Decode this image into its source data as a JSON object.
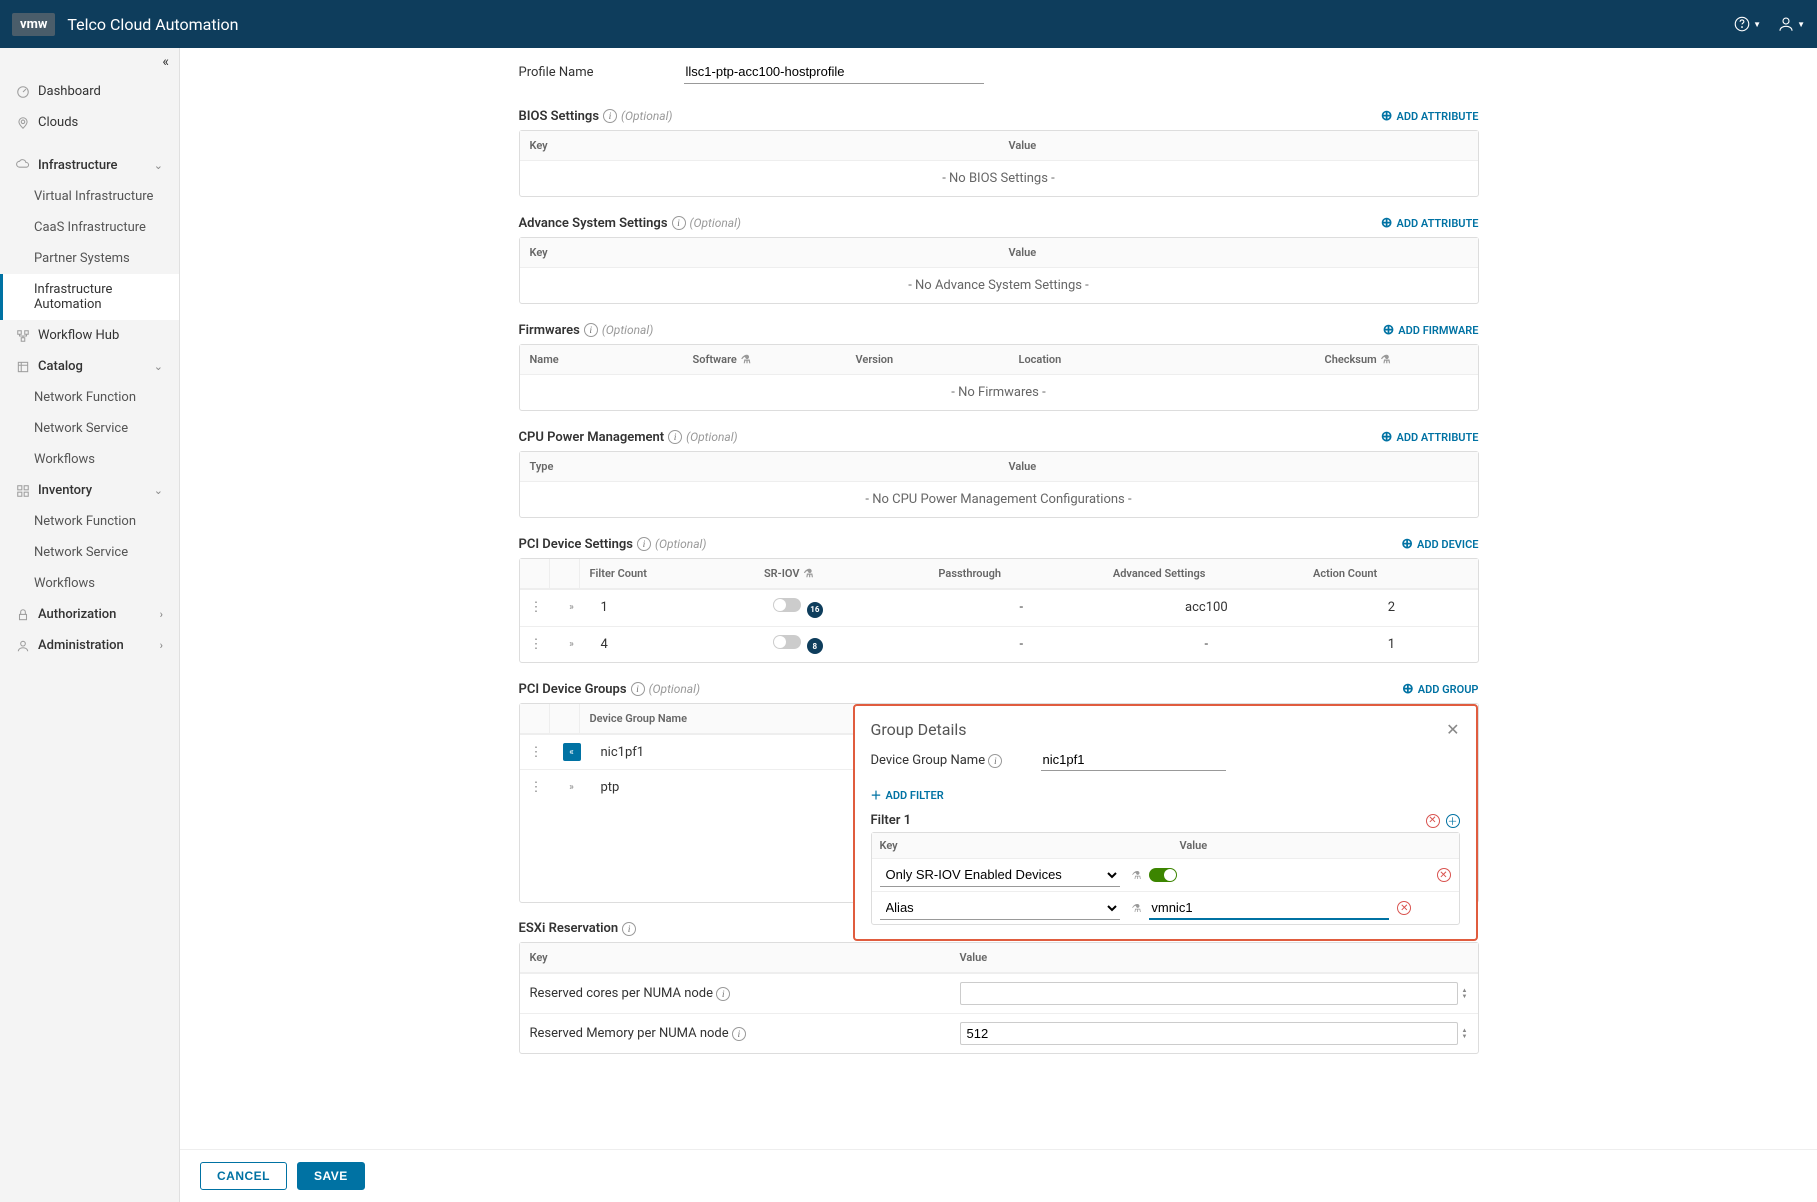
{
  "header": {
    "logo": "vmw",
    "title": "Telco Cloud Automation"
  },
  "sidebar": {
    "dashboard": "Dashboard",
    "clouds": "Clouds",
    "infrastructure": {
      "label": "Infrastructure",
      "items": [
        "Virtual Infrastructure",
        "CaaS Infrastructure",
        "Partner Systems",
        "Infrastructure Automation"
      ]
    },
    "workflow_hub": "Workflow Hub",
    "catalog": {
      "label": "Catalog",
      "items": [
        "Network Function",
        "Network Service",
        "Workflows"
      ]
    },
    "inventory": {
      "label": "Inventory",
      "items": [
        "Network Function",
        "Network Service",
        "Workflows"
      ]
    },
    "authorization": "Authorization",
    "administration": "Administration"
  },
  "form": {
    "profile_name_label": "Profile Name",
    "profile_name_value": "llsc1-ptp-acc100-hostprofile"
  },
  "optional": "(Optional)",
  "add_attribute": "ADD ATTRIBUTE",
  "add_firmware": "ADD FIRMWARE",
  "add_device": "ADD DEVICE",
  "add_group": "ADD GROUP",
  "bios": {
    "title": "BIOS Settings",
    "key": "Key",
    "value": "Value",
    "empty": "- No BIOS Settings -"
  },
  "advance": {
    "title": "Advance System Settings",
    "key": "Key",
    "value": "Value",
    "empty": "- No Advance System Settings -"
  },
  "firmwares": {
    "title": "Firmwares",
    "cols": {
      "name": "Name",
      "software": "Software",
      "version": "Version",
      "location": "Location",
      "checksum": "Checksum"
    },
    "empty": "- No Firmwares -"
  },
  "cpu": {
    "title": "CPU Power Management",
    "type": "Type",
    "value": "Value",
    "empty": "- No CPU Power Management Configurations -"
  },
  "pci_settings": {
    "title": "PCI Device Settings",
    "cols": {
      "filter_count": "Filter Count",
      "sriov": "SR-IOV",
      "passthrough": "Passthrough",
      "advanced": "Advanced Settings",
      "action_count": "Action Count"
    },
    "rows": [
      {
        "filter_count": "1",
        "sriov_badge": "16",
        "passthrough": "-",
        "advanced": "acc100",
        "action_count": "2"
      },
      {
        "filter_count": "4",
        "sriov_badge": "8",
        "passthrough": "-",
        "advanced": "-",
        "action_count": "1"
      }
    ]
  },
  "pci_groups": {
    "title": "PCI Device Groups",
    "col": "Device Group Name",
    "rows": [
      "nic1pf1",
      "ptp"
    ]
  },
  "panel": {
    "title": "Group Details",
    "name_label": "Device Group Name",
    "name_value": "nic1pf1",
    "add_filter": "ADD FILTER",
    "filter_title": "Filter 1",
    "key": "Key",
    "value": "Value",
    "row1_key": "Only SR-IOV Enabled Devices",
    "row2_key": "Alias",
    "row2_value": "vmnic1"
  },
  "esxi": {
    "title": "ESXi Reservation",
    "key": "Key",
    "value": "Value",
    "row1": "Reserved cores per NUMA node",
    "row2": "Reserved Memory per NUMA node",
    "row2_value": "512"
  },
  "footer": {
    "cancel": "CANCEL",
    "save": "SAVE"
  }
}
